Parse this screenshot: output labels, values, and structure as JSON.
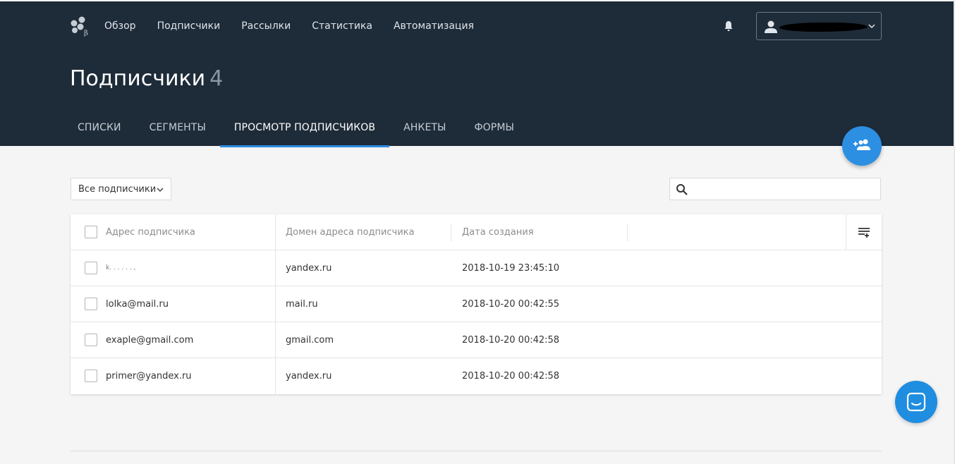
{
  "nav": {
    "items": [
      "Обзор",
      "Подписчики",
      "Рассылки",
      "Статистика",
      "Автоматизация"
    ]
  },
  "page": {
    "title": "Подписчики",
    "count": "4"
  },
  "tabs": [
    {
      "label": "СПИСКИ",
      "active": false
    },
    {
      "label": "СЕГМЕНТЫ",
      "active": false
    },
    {
      "label": "ПРОСМОТР ПОДПИСЧИКОВ",
      "active": true
    },
    {
      "label": "АНКЕТЫ",
      "active": false
    },
    {
      "label": "ФОРМЫ",
      "active": false
    }
  ],
  "filter": {
    "selected": "Все подписчики"
  },
  "search": {
    "value": "",
    "placeholder": ""
  },
  "table": {
    "columns": [
      "Адрес подписчика",
      "Домен адреса подписчика",
      "Дата создания"
    ],
    "rows": [
      {
        "email": "k. .  .  . .  .  ,",
        "domain": "yandex.ru",
        "created": "2018-10-19 23:45:10"
      },
      {
        "email": "lolka@mail.ru",
        "domain": "mail.ru",
        "created": "2018-10-20 00:42:55"
      },
      {
        "email": "exaple@gmail.com",
        "domain": "gmail.com",
        "created": "2018-10-20 00:42:58"
      },
      {
        "email": "primer@yandex.ru",
        "domain": "yandex.ru",
        "created": "2018-10-20 00:42:58"
      }
    ]
  },
  "icons": {
    "logo": "logo-icon",
    "bell": "bell-icon",
    "user": "user-icon",
    "add_subscriber": "add-group-icon",
    "search": "search-icon",
    "columns": "column-settings-icon",
    "chat": "chat-icon"
  },
  "colors": {
    "header_bg": "#1e2b38",
    "accent": "#2d8fe2",
    "page_bg": "#f5f5f5"
  }
}
